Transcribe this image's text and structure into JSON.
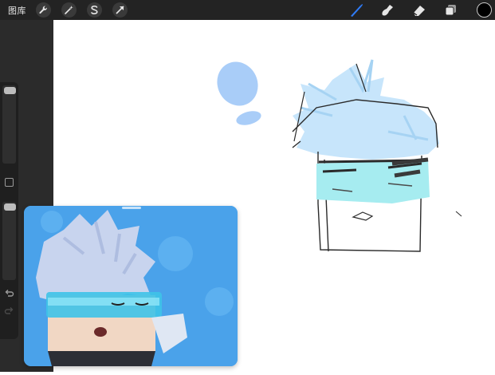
{
  "topbar": {
    "gallery_label": "图库",
    "left_tools": [
      "wrench-icon",
      "magic-wand-icon",
      "selection-icon",
      "transform-icon"
    ],
    "right_tools": [
      "brush-icon",
      "smudge-icon",
      "eraser-icon",
      "layers-icon"
    ],
    "active_tool": "brush-icon",
    "accent_color": "#2f7bf5",
    "current_color": "#000000"
  },
  "sidebar": {
    "size_level": 0.95,
    "opacity_level": 0.95,
    "icons": [
      "modify-square-icon",
      "undo-icon",
      "redo-icon"
    ]
  },
  "pip": {
    "background_color": "#4aa2ea"
  }
}
